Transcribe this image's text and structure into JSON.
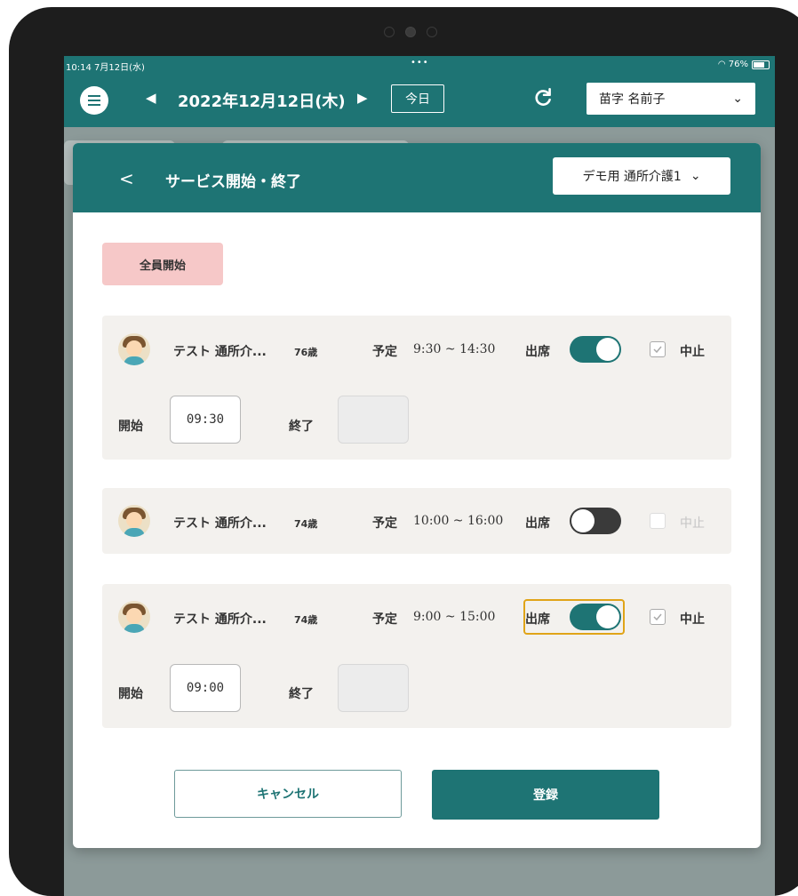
{
  "status_bar": {
    "time": "10:14  7月12日(水)",
    "dots": "•••",
    "battery": "76%"
  },
  "header": {
    "date": "2022年12月12日(木)",
    "today_label": "今日",
    "user_name": "苗字 名前子"
  },
  "modal": {
    "title": "サービス開始・終了",
    "facility": "デモ用 通所介護1",
    "all_start_label": "全員開始",
    "cancel_button": "キャンセル",
    "register_button": "登録"
  },
  "labels": {
    "plan": "予定",
    "attend": "出席",
    "cancel": "中止",
    "start": "開始",
    "end": "終了"
  },
  "rows": [
    {
      "name": "テスト 通所介...",
      "age": "76歳",
      "plan_time": "9:30 ~ 14:30",
      "attending": true,
      "cancelled": false,
      "start_time": "09:30",
      "end_time": ""
    },
    {
      "name": "テスト 通所介...",
      "age": "74歳",
      "plan_time": "10:00 ~ 16:00",
      "attending": false,
      "cancelled": false,
      "start_time": "",
      "end_time": ""
    },
    {
      "name": "テスト 通所介...",
      "age": "74歳",
      "plan_time": "9:00 ~ 15:00",
      "attending": true,
      "cancelled": false,
      "start_time": "09:00",
      "end_time": ""
    }
  ],
  "colors": {
    "primary": "#1e7474",
    "all_start_bg": "#f6c8c8",
    "row_bg": "#f3f1ee",
    "focus": "#e0a418"
  }
}
